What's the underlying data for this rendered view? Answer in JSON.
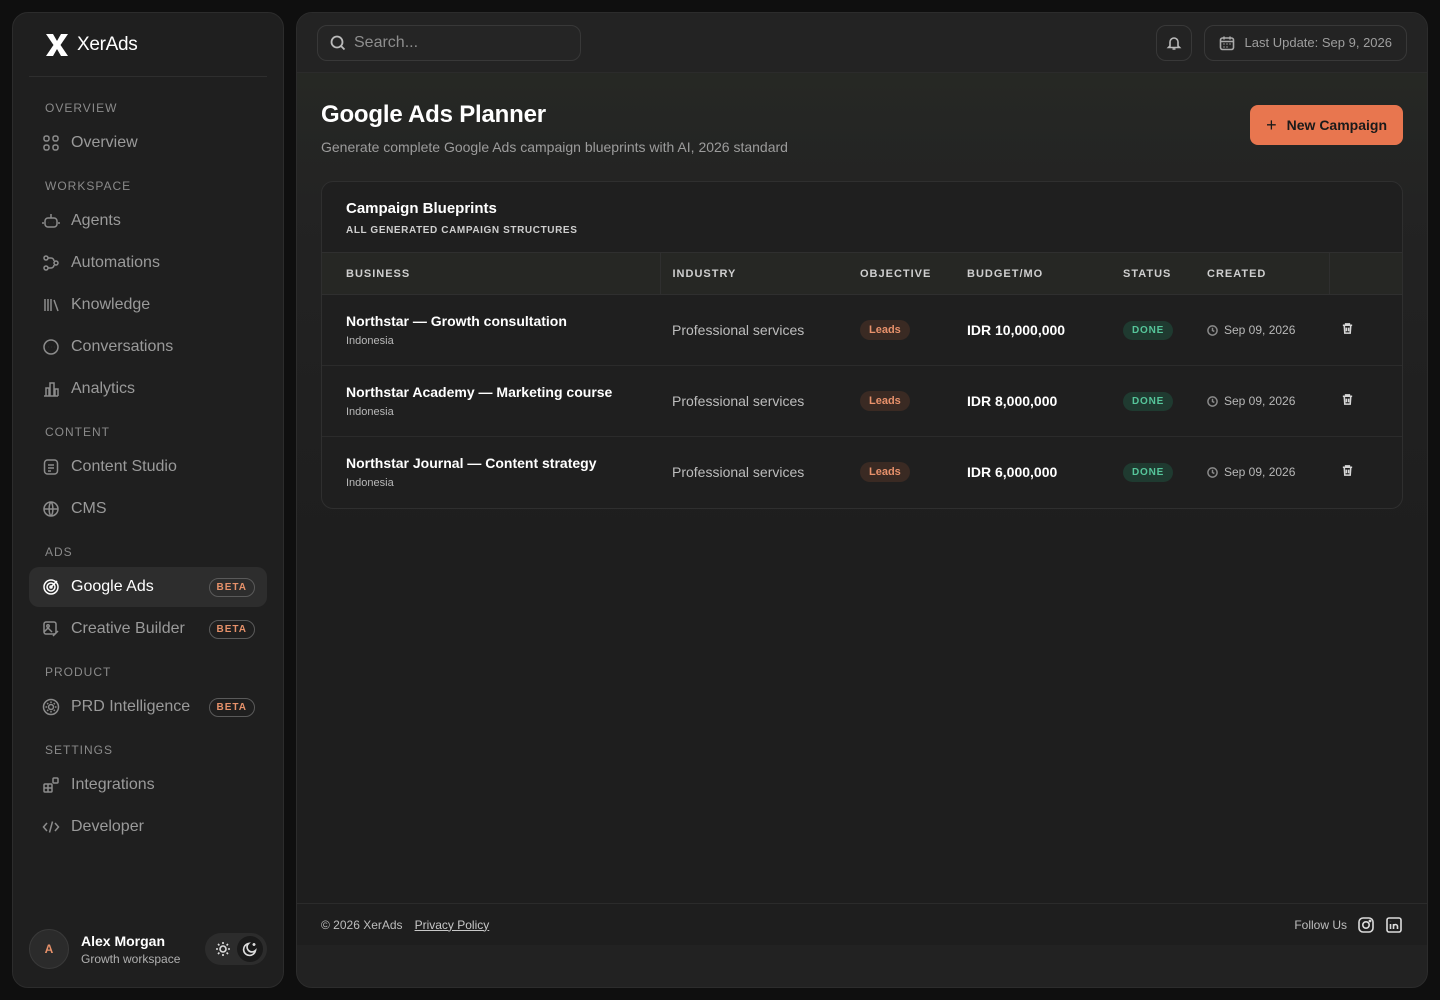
{
  "brand": {
    "name": "XerAds",
    "icon": "x-logo-icon"
  },
  "sidebar": {
    "sections": [
      {
        "label": "OVERVIEW",
        "items": [
          {
            "label": "Overview",
            "icon": "grid-icon"
          }
        ]
      },
      {
        "label": "WORKSPACE",
        "items": [
          {
            "label": "Agents",
            "icon": "robot-icon"
          },
          {
            "label": "Automations",
            "icon": "workflow-icon"
          },
          {
            "label": "Knowledge",
            "icon": "library-icon"
          },
          {
            "label": "Conversations",
            "icon": "chat-icon"
          },
          {
            "label": "Analytics",
            "icon": "building-chart-icon"
          }
        ]
      },
      {
        "label": "CONTENT",
        "items": [
          {
            "label": "Content Studio",
            "icon": "document-icon"
          },
          {
            "label": "CMS",
            "icon": "globe-icon"
          }
        ]
      },
      {
        "label": "ADS",
        "items": [
          {
            "label": "Google Ads",
            "icon": "target-icon",
            "badge": "BETA",
            "active": true
          },
          {
            "label": "Creative Builder",
            "icon": "image-edit-icon",
            "badge": "BETA"
          }
        ]
      },
      {
        "label": "PRODUCT",
        "items": [
          {
            "label": "PRD Intelligence",
            "icon": "cog-circle-icon",
            "badge": "BETA"
          }
        ]
      },
      {
        "label": "SETTINGS",
        "items": [
          {
            "label": "Integrations",
            "icon": "blocks-icon"
          },
          {
            "label": "Developer",
            "icon": "code-icon"
          }
        ]
      }
    ]
  },
  "user": {
    "initial": "A",
    "name": "Alex Morgan",
    "workspace": "Growth workspace"
  },
  "topbar": {
    "search_placeholder": "Search...",
    "last_update": "Last Update: Sep 9, 2026"
  },
  "page": {
    "title": "Google Ads Planner",
    "subtitle": "Generate complete Google Ads campaign blueprints with AI, 2026 standard",
    "new_button": "New Campaign"
  },
  "card": {
    "title": "Campaign Blueprints",
    "subtitle": "ALL GENERATED CAMPAIGN STRUCTURES",
    "columns": [
      "BUSINESS",
      "INDUSTRY",
      "OBJECTIVE",
      "BUDGET/MO",
      "STATUS",
      "CREATED"
    ],
    "rows": [
      {
        "business": "Northstar — Growth consultation",
        "location": "Indonesia",
        "industry": "Professional services",
        "objective": "Leads",
        "budget": "IDR 10,000,000",
        "status": "DONE",
        "created": "Sep 09, 2026"
      },
      {
        "business": "Northstar Academy — Marketing course",
        "location": "Indonesia",
        "industry": "Professional services",
        "objective": "Leads",
        "budget": "IDR 8,000,000",
        "status": "DONE",
        "created": "Sep 09, 2026"
      },
      {
        "business": "Northstar Journal — Content strategy",
        "location": "Indonesia",
        "industry": "Professional services",
        "objective": "Leads",
        "budget": "IDR 6,000,000",
        "status": "DONE",
        "created": "Sep 09, 2026"
      }
    ]
  },
  "footer": {
    "copyright": "© 2026 XerAds",
    "privacy": "Privacy Policy",
    "follow": "Follow Us"
  },
  "colors": {
    "accent": "#e8764f",
    "done": "#56c59a",
    "background": "#1e1e1e"
  }
}
